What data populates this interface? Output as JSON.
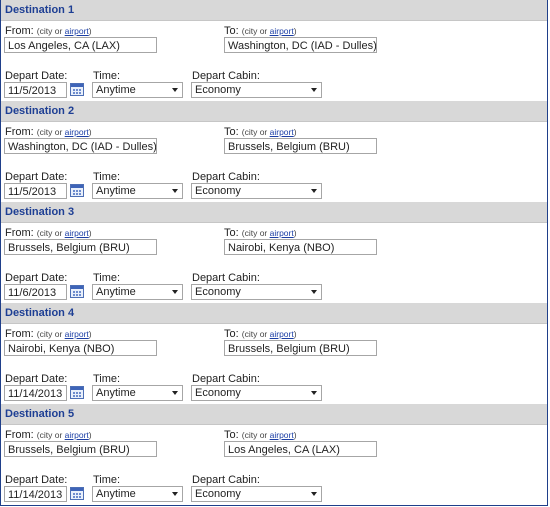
{
  "labels": {
    "from": "From:",
    "to": "To:",
    "hint_prefix": "(city or ",
    "hint_link": "airport",
    "hint_suffix": ")",
    "depart_date": "Depart Date:",
    "time": "Time:",
    "depart_cabin": "Depart Cabin:"
  },
  "destinations": [
    {
      "title": "Destination 1",
      "from": "Los Angeles, CA (LAX)",
      "to": "Washington, DC (IAD - Dulles)",
      "date": "11/5/2013",
      "time": "Anytime",
      "cabin": "Economy"
    },
    {
      "title": "Destination 2",
      "from": "Washington, DC (IAD - Dulles)",
      "to": "Brussels, Belgium (BRU)",
      "date": "11/5/2013",
      "time": "Anytime",
      "cabin": "Economy"
    },
    {
      "title": "Destination 3",
      "from": "Brussels, Belgium (BRU)",
      "to": "Nairobi, Kenya (NBO)",
      "date": "11/6/2013",
      "time": "Anytime",
      "cabin": "Economy"
    },
    {
      "title": "Destination 4",
      "from": "Nairobi, Kenya (NBO)",
      "to": "Brussels, Belgium (BRU)",
      "date": "11/14/2013",
      "time": "Anytime",
      "cabin": "Economy"
    },
    {
      "title": "Destination 5",
      "from": "Brussels, Belgium (BRU)",
      "to": "Los Angeles, CA (LAX)",
      "date": "11/14/2013",
      "time": "Anytime",
      "cabin": "Economy"
    }
  ],
  "colors": {
    "header_bg": "#d8d8d8",
    "title_text": "#1e3f94",
    "link": "#1b3ea5",
    "frame_border": "#1f3f8a"
  }
}
